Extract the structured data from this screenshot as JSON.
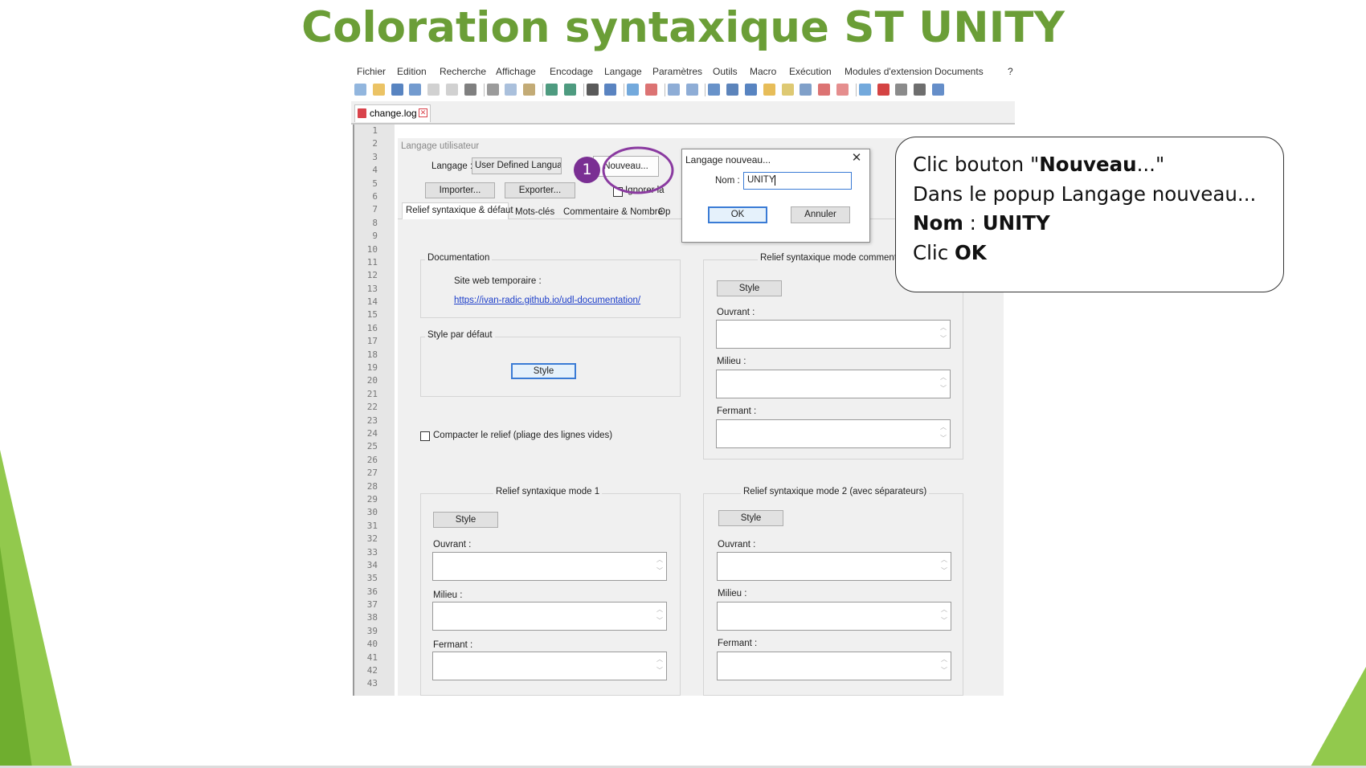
{
  "slide": {
    "title": "Coloration syntaxique ST UNITY",
    "accent_color": "#6b9e37",
    "highlight_color": "#8a3aa0"
  },
  "menu": [
    "Fichier",
    "Edition",
    "Recherche",
    "Affichage",
    "Encodage",
    "Langage",
    "Paramètres",
    "Outils",
    "Macro",
    "Exécution",
    "Modules d'extension",
    "Documents",
    "?"
  ],
  "tab": {
    "label": "change.log",
    "icon": "file-unsaved-icon"
  },
  "toolbar_icons": [
    "new-file-icon",
    "open-icon",
    "save-icon",
    "save-all-icon",
    "close-icon",
    "close-all-icon",
    "print-icon",
    "cut-icon",
    "copy-icon",
    "paste-icon",
    "undo-icon",
    "redo-icon",
    "find-icon",
    "replace-icon",
    "zoom-in-icon",
    "zoom-out-icon",
    "sync-v-icon",
    "sync-h-icon",
    "wrap-icon",
    "all-chars-icon",
    "indent-guide-icon",
    "udl-icon",
    "doc-map-icon",
    "func-list-icon",
    "folder-icon",
    "monitor-icon",
    "record-macro-icon",
    "stop-macro-icon",
    "play-macro-icon",
    "run-macro-icon",
    "save-macro-icon"
  ],
  "line_numbers": [
    "1",
    "2",
    "3",
    "4",
    "5",
    "6",
    "7",
    "8",
    "9",
    "10",
    "11",
    "12",
    "13",
    "14",
    "15",
    "16",
    "17",
    "18",
    "19",
    "20",
    "21",
    "22",
    "23",
    "24",
    "25",
    "26",
    "27",
    "28",
    "29",
    "30",
    "31",
    "32",
    "33",
    "34",
    "35",
    "36",
    "37",
    "38",
    "39",
    "40",
    "41",
    "42",
    "43"
  ],
  "udl": {
    "panel_title": "Langage utilisateur",
    "language_label": "Langage :",
    "language_value": "User Defined Languag",
    "new_button": "Nouveau...",
    "import_button": "Importer...",
    "export_button": "Exporter...",
    "ignore_case": "Ignorer la",
    "step_badge": "1",
    "tabs": [
      "Relief syntaxique & défaut",
      "Mots-clés",
      "Commentaire & Nombre",
      "Op"
    ],
    "documentation": {
      "title": "Documentation",
      "site_label": "Site web temporaire :",
      "link": "https://ivan-radic.github.io/udl-documentation/"
    },
    "default_style": {
      "title": "Style par défaut",
      "button": "Style"
    },
    "fold_compact": "Compacter le relief (pliage des lignes vides)",
    "comment_mode": {
      "title": "Relief syntaxique mode commenta",
      "style_button": "Style",
      "open": "Ouvrant :",
      "middle": "Milieu :",
      "close": "Fermant :"
    },
    "mode1": {
      "title": "Relief syntaxique mode 1",
      "style_button": "Style",
      "open": "Ouvrant :",
      "middle": "Milieu :",
      "close": "Fermant :"
    },
    "mode2": {
      "title": "Relief syntaxique mode 2 (avec séparateurs)",
      "style_button": "Style",
      "open": "Ouvrant :",
      "middle": "Milieu :",
      "close": "Fermant :"
    }
  },
  "popup": {
    "title": "Langage nouveau...",
    "name_label": "Nom :",
    "name_value": "UNITY",
    "ok_button": "OK",
    "cancel_button": "Annuler"
  },
  "callout": {
    "line1_prefix": "Clic bouton \"",
    "line1_bold": "Nouveau",
    "line1_suffix": "...\"",
    "line2": "Dans le popup Langage nouveau...",
    "line3_bold_a": "Nom",
    "line3_sep": " : ",
    "line3_bold_b": "UNITY",
    "line4_prefix": "Clic ",
    "line4_bold": "OK"
  }
}
